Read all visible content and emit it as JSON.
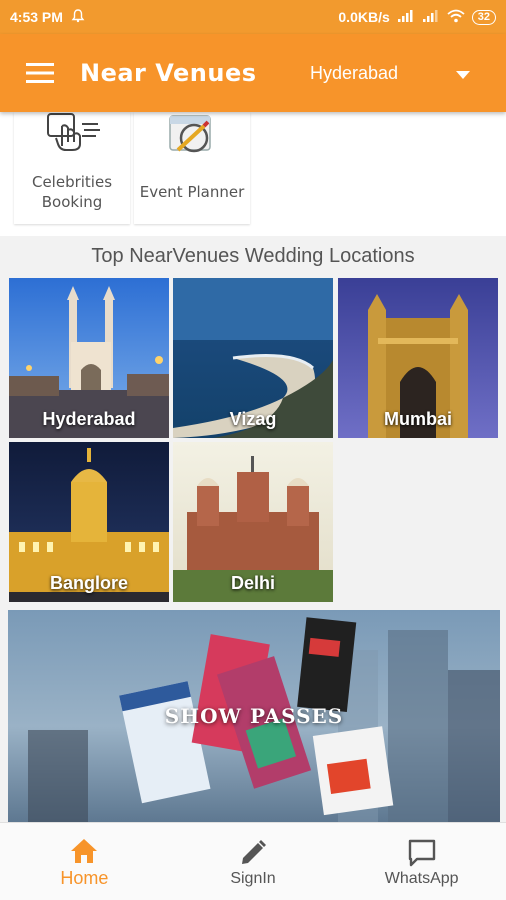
{
  "status_bar": {
    "time": "4:53 PM",
    "network_speed": "0.0KB/s",
    "battery": "32"
  },
  "app_bar": {
    "title": "Near Venues",
    "city": "Hyderabad",
    "menu_icon": "hamburger-menu-icon",
    "dropdown_icon": "caret-down-icon"
  },
  "services": [
    {
      "label_line1": "Celebrities",
      "label_line2": "Booking",
      "icon": "hand-pointer-icon"
    },
    {
      "label": "Event Planner",
      "icon": "calendar-pen-icon"
    }
  ],
  "locations_section": {
    "title": "Top NearVenues Wedding Locations",
    "cities": [
      "Hyderabad",
      "Vizag",
      "Mumbai",
      "Banglore",
      "Delhi"
    ]
  },
  "promo": {
    "headline": "SHOW PASSES"
  },
  "bottom_nav": {
    "active_color": "#f7942a",
    "items": [
      {
        "label": "Home",
        "icon": "home-icon",
        "active": true
      },
      {
        "label": "SignIn",
        "icon": "pencil-icon",
        "active": false
      },
      {
        "label": "WhatsApp",
        "icon": "chat-bubble-icon",
        "active": false
      }
    ]
  },
  "colors": {
    "accent": "#f7942a",
    "status_bar": "#f29a2e"
  }
}
